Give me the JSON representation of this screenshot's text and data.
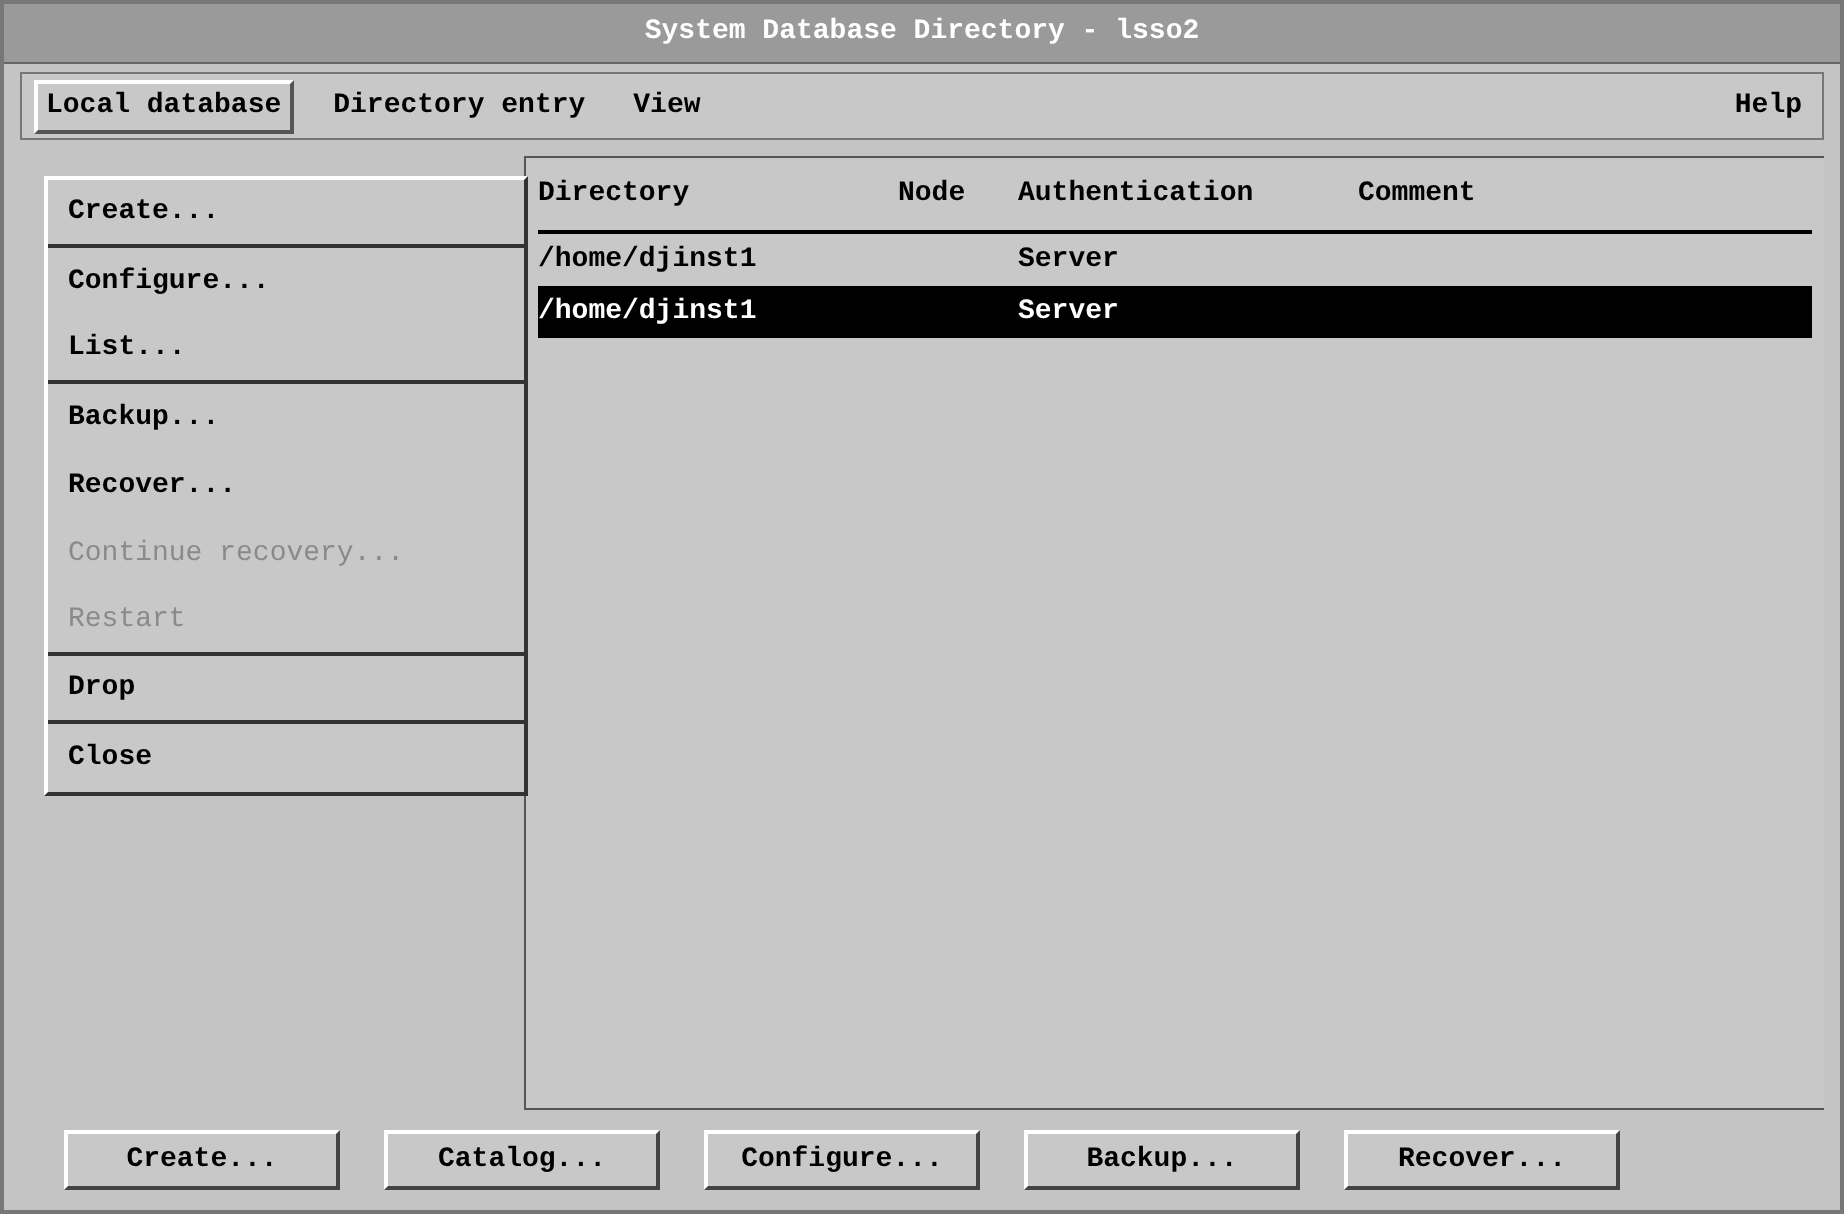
{
  "window": {
    "title": "System Database Directory - lsso2"
  },
  "menu_bar": [
    {
      "label": "Local database",
      "selected": true
    },
    {
      "label": "Directory entry",
      "selected": false
    },
    {
      "label": "View",
      "selected": false
    },
    {
      "label": "Help",
      "selected": false
    }
  ],
  "dropdown": [
    {
      "label": "Create...",
      "disabled": false,
      "separator_after": true
    },
    {
      "label": "Configure...",
      "disabled": false,
      "separator_after": false
    },
    {
      "label": "List...",
      "disabled": false,
      "separator_after": true
    },
    {
      "label": "Backup...",
      "disabled": false,
      "separator_after": false
    },
    {
      "label": "Recover...",
      "disabled": false,
      "separator_after": false
    },
    {
      "label": "Continue recovery...",
      "disabled": true,
      "separator_after": false
    },
    {
      "label": "Restart",
      "disabled": true,
      "separator_after": true
    },
    {
      "label": "Drop",
      "disabled": false,
      "separator_after": true
    },
    {
      "label": "Close",
      "disabled": false,
      "separator_after": false
    }
  ],
  "table": {
    "columns": [
      "Directory",
      "Node",
      "Authentication",
      "Comment"
    ],
    "rows": [
      {
        "cells": [
          "/home/djinst1",
          "",
          "Server",
          ""
        ],
        "selected": false
      },
      {
        "cells": [
          "/home/djinst1",
          "",
          "Server",
          ""
        ],
        "selected": true
      }
    ]
  },
  "buttons": [
    "Create...",
    "Catalog...",
    "Configure...",
    "Backup...",
    "Recover..."
  ]
}
